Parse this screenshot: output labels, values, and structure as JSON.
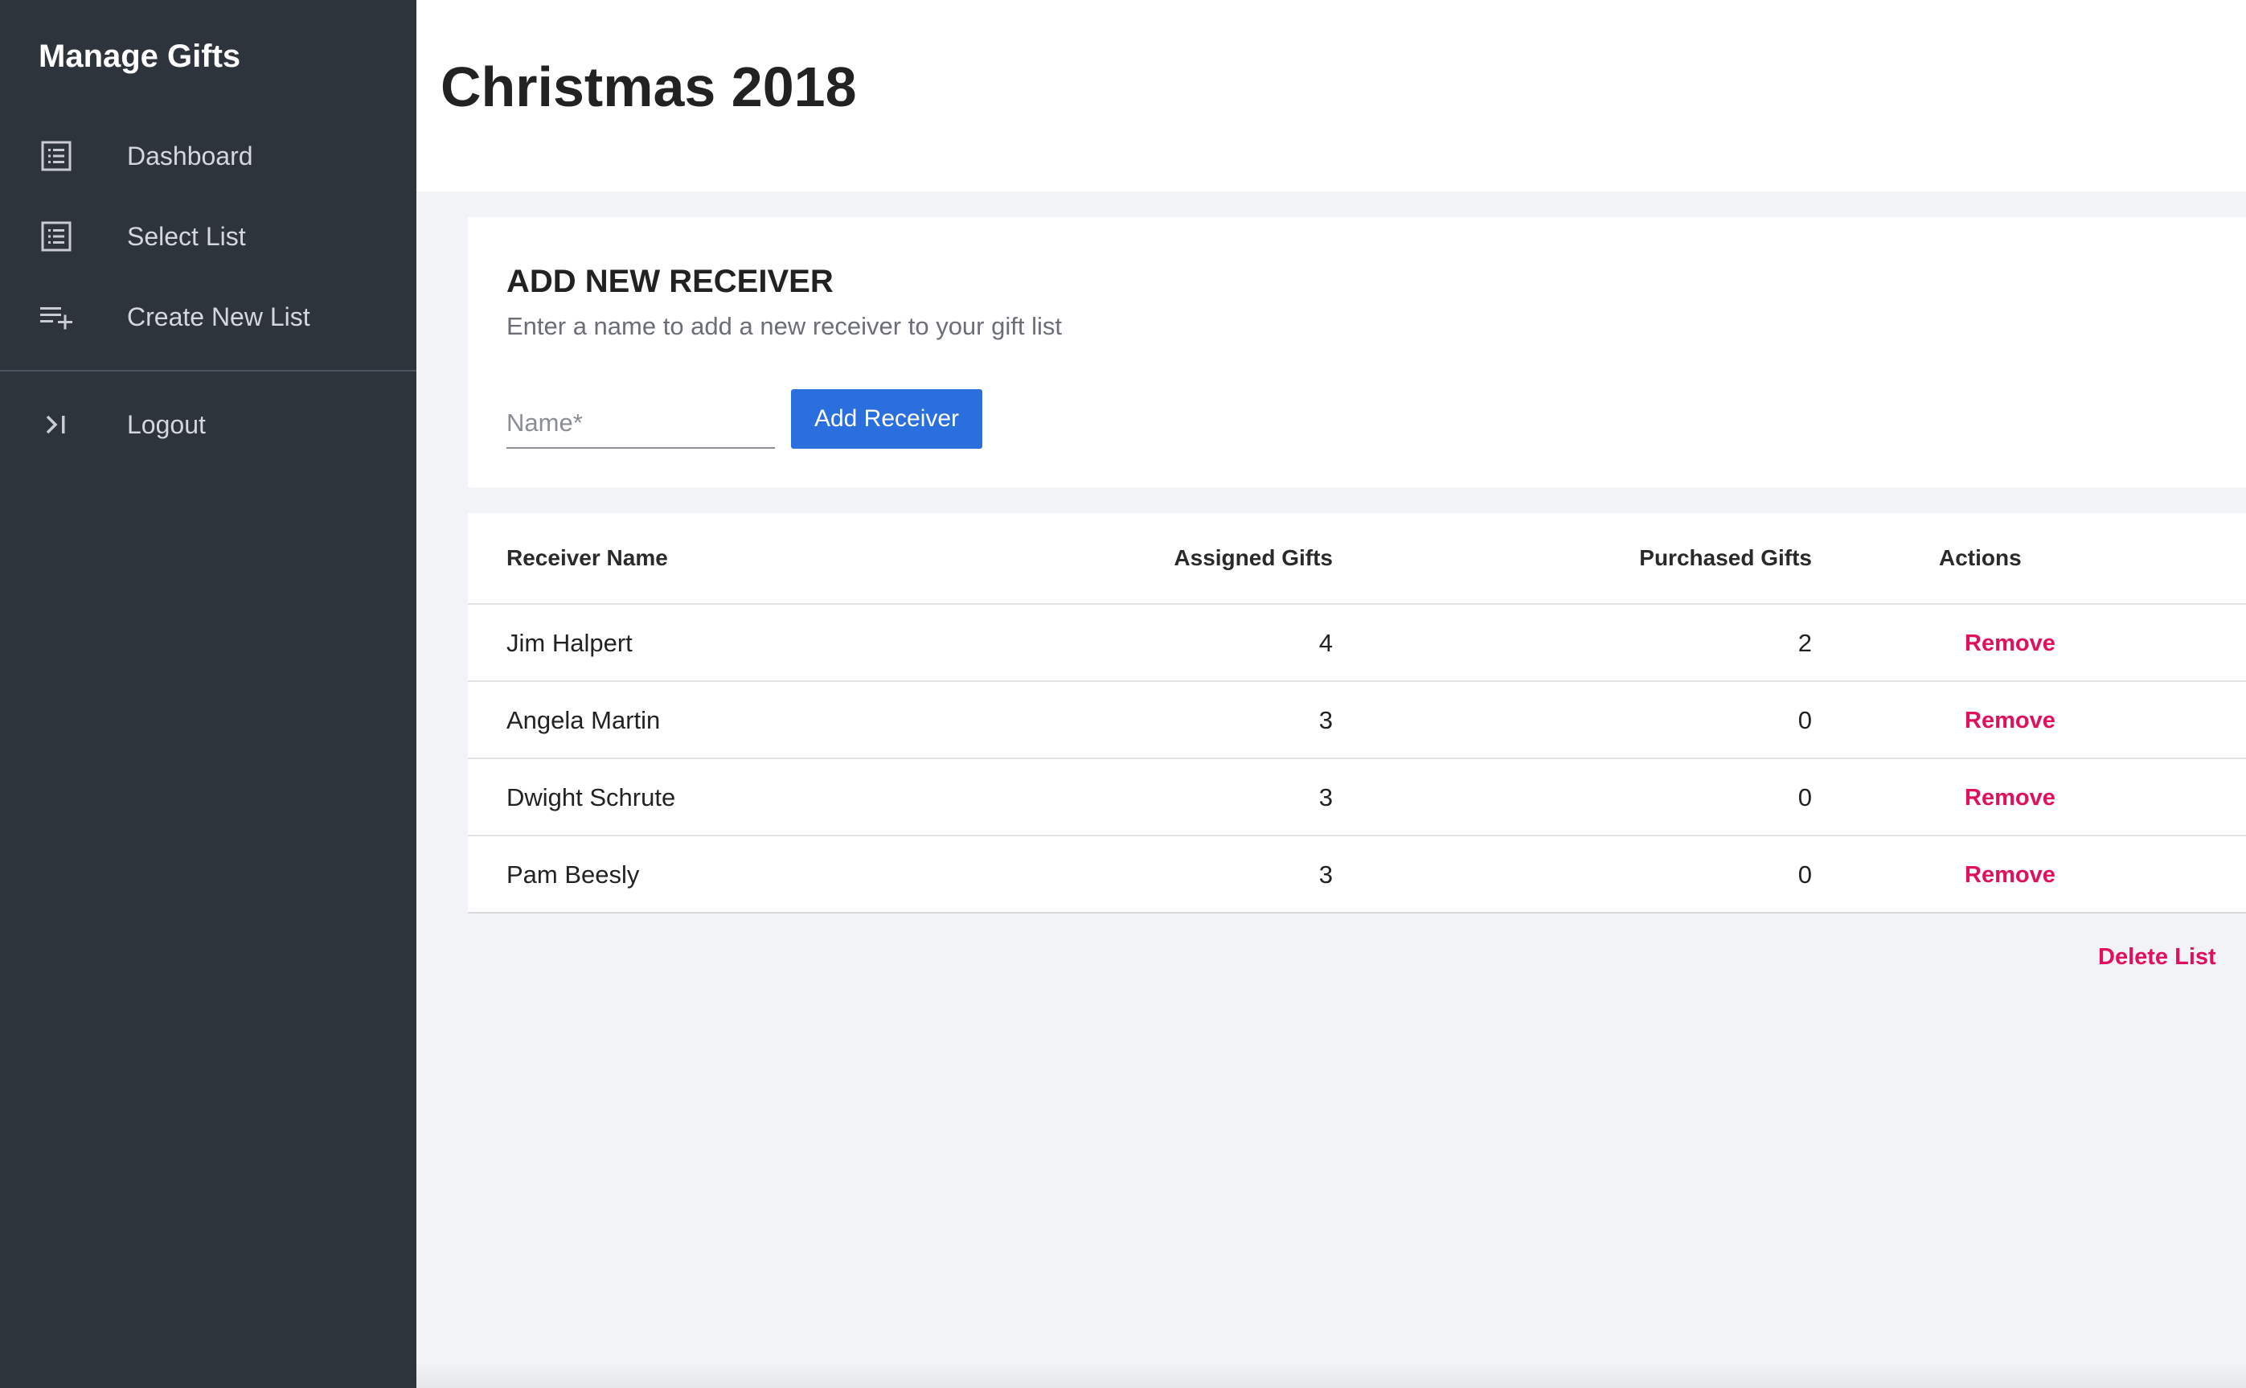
{
  "sidebar": {
    "brand": "Manage Gifts",
    "items": [
      {
        "label": "Dashboard",
        "icon": "list-icon"
      },
      {
        "label": "Select List",
        "icon": "list-icon"
      },
      {
        "label": "Create New List",
        "icon": "playlist-add-icon"
      }
    ],
    "logout": {
      "label": "Logout",
      "icon": "logout-icon"
    }
  },
  "header": {
    "title": "Christmas 2018"
  },
  "add_receiver": {
    "title": "ADD NEW RECEIVER",
    "subtitle": "Enter a name to add a new receiver to your gift list",
    "name_placeholder": "Name*",
    "button_label": "Add Receiver"
  },
  "table": {
    "headers": [
      "Receiver Name",
      "Assigned Gifts",
      "Purchased Gifts",
      "Actions"
    ],
    "rows": [
      {
        "name": "Jim Halpert",
        "assigned": "4",
        "purchased": "2",
        "action": "Remove"
      },
      {
        "name": "Angela Martin",
        "assigned": "3",
        "purchased": "0",
        "action": "Remove"
      },
      {
        "name": "Dwight Schrute",
        "assigned": "3",
        "purchased": "0",
        "action": "Remove"
      },
      {
        "name": "Pam Beesly",
        "assigned": "3",
        "purchased": "0",
        "action": "Remove"
      }
    ]
  },
  "footer": {
    "delete_label": "Delete List"
  },
  "colors": {
    "sidebar_bg": "#2e343c",
    "accent_button": "#2b6fdf",
    "danger_link": "#e0105f"
  }
}
